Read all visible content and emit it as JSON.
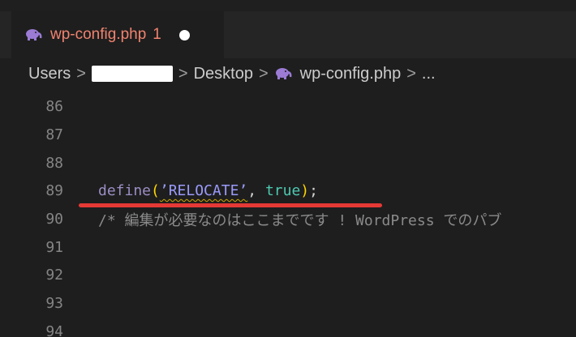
{
  "tab": {
    "filename": "wp-config.php",
    "problem_count": "1",
    "icon": "php-elephant-icon"
  },
  "breadcrumb": {
    "items": [
      "Users",
      "Desktop",
      "wp-config.php",
      "..."
    ],
    "separator": ">"
  },
  "editor": {
    "lines": [
      {
        "number": "86",
        "code": ""
      },
      {
        "number": "87",
        "code": ""
      },
      {
        "number": "88",
        "code": ""
      },
      {
        "number": "89",
        "tokens": {
          "fn": "define",
          "open": "(",
          "str": "’RELOCATE’",
          "comma": ",",
          "const": "true",
          "close": ")",
          "semi": ";"
        }
      },
      {
        "number": "90",
        "comment": "/* 編集が必要なのはここまでです ! WordPress でのパブ"
      },
      {
        "number": "91",
        "code": ""
      },
      {
        "number": "92",
        "code": ""
      },
      {
        "number": "93",
        "code": ""
      },
      {
        "number": "94",
        "code": ""
      }
    ]
  },
  "colors": {
    "accent": "#f0836f",
    "annotation": "#e53935",
    "icon": "#9b7bd4"
  }
}
